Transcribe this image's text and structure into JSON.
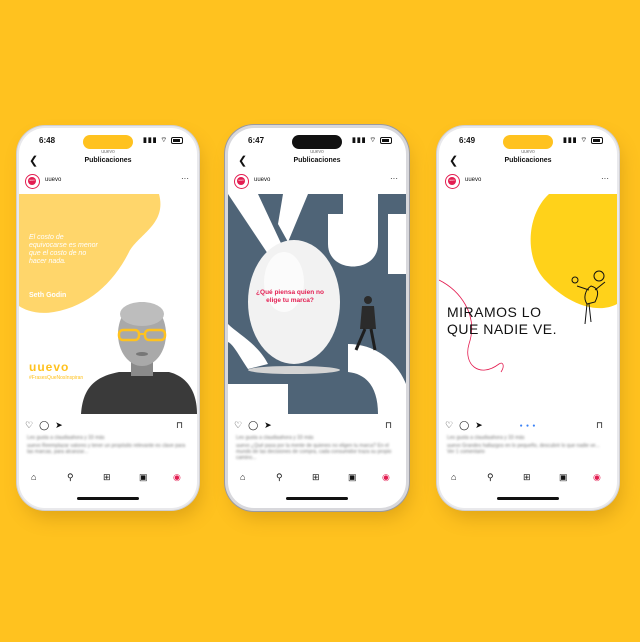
{
  "phones": [
    {
      "time": "6:48",
      "top_user": "uuevo",
      "header_title": "Publicaciones",
      "username": "uuevo",
      "quote": "El costo de equivocarse es menor que el costo de no hacer nada.",
      "author": "Seth Godin",
      "brand": "uuevo",
      "hashtag": "#FrasesQueNosInspiran",
      "likes": "Les gusta a claudiaahora y 33 más",
      "caption": "uuevo Reemplazar valores y tener un propósito relevante es clave para las marcas, para alcanzar..."
    },
    {
      "time": "6:47",
      "top_user": "uuevo",
      "header_title": "Publicaciones",
      "username": "uuevo",
      "post_text": "¿Qué piensa quien no elige tu marca?",
      "likes": "Les gusta a claudiaahora y 33 más",
      "caption": "uuevo ¿Qué pasa por la mente de quienes no eligen tu marca? En el mundo de las decisiones de compra, cada consumidor traza su propio camino..."
    },
    {
      "time": "6:49",
      "top_user": "uuevo",
      "header_title": "Publicaciones",
      "username": "uuevo",
      "post_text_line1": "MIRAMOS LO",
      "post_text_line2": "QUE NADIE VE.",
      "likes": "Les gusta a claudiaahora y 33 más",
      "caption": "uuevo Grandes hallazgos en lo pequeño, descubrir lo que nadie ve...",
      "comments": "Ver 1 comentario"
    }
  ],
  "colors": {
    "background": "#FFC21F",
    "accent_red": "#e31d51",
    "slate": "#4f6477",
    "yellow": "#FFC21F"
  },
  "icons": [
    "back-icon",
    "more-icon",
    "heart-icon",
    "comment-icon",
    "share-icon",
    "bookmark-icon",
    "home-icon",
    "search-icon",
    "add-icon",
    "reels-icon",
    "profile-icon"
  ]
}
